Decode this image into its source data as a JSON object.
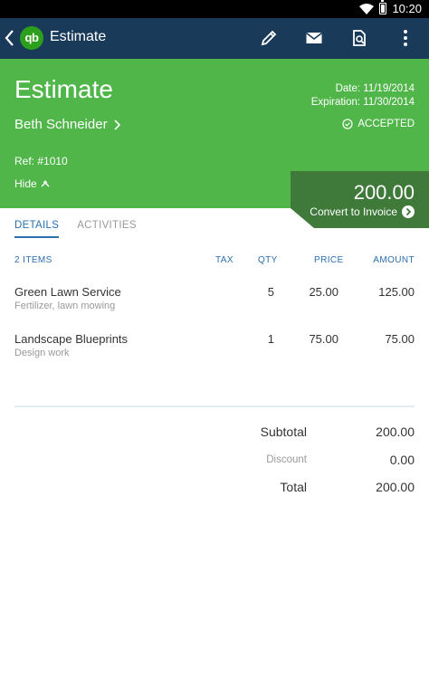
{
  "status_bar": {
    "time": "10:20"
  },
  "app_bar": {
    "logo_text": "qb",
    "title": "Estimate"
  },
  "header": {
    "title": "Estimate",
    "date": "Date: 11/19/2014",
    "expiration": "Expiration: 11/30/2014",
    "customer": "Beth Schneider",
    "status": "ACCEPTED",
    "ref": "Ref: #1010",
    "hide": "Hide",
    "total": "200.00",
    "convert": "Convert to Invoice"
  },
  "tabs": [
    {
      "label": "DETAILS"
    },
    {
      "label": "ACTIVITIES"
    }
  ],
  "table": {
    "headers": {
      "items": "2  ITEMS",
      "tax": "TAX",
      "qty": "QTY",
      "price": "PRICE",
      "amount": "AMOUNT"
    },
    "rows": [
      {
        "name": "Green Lawn Service",
        "desc": "Fertilizer, lawn mowing",
        "qty": "5",
        "price": "25.00",
        "amount": "125.00"
      },
      {
        "name": "Landscape Blueprints",
        "desc": "Design work",
        "qty": "1",
        "price": "75.00",
        "amount": "75.00"
      }
    ]
  },
  "summary": {
    "subtotal_label": "Subtotal",
    "subtotal": "200.00",
    "discount_label": "Discount",
    "discount": "0.00",
    "total_label": "Total",
    "total": "200.00"
  },
  "colors": {
    "app_bar": "#1a3a5a",
    "header_green": "#51b64a",
    "total_box": "#3f7a3a",
    "accent_blue": "#2b6fb0"
  }
}
